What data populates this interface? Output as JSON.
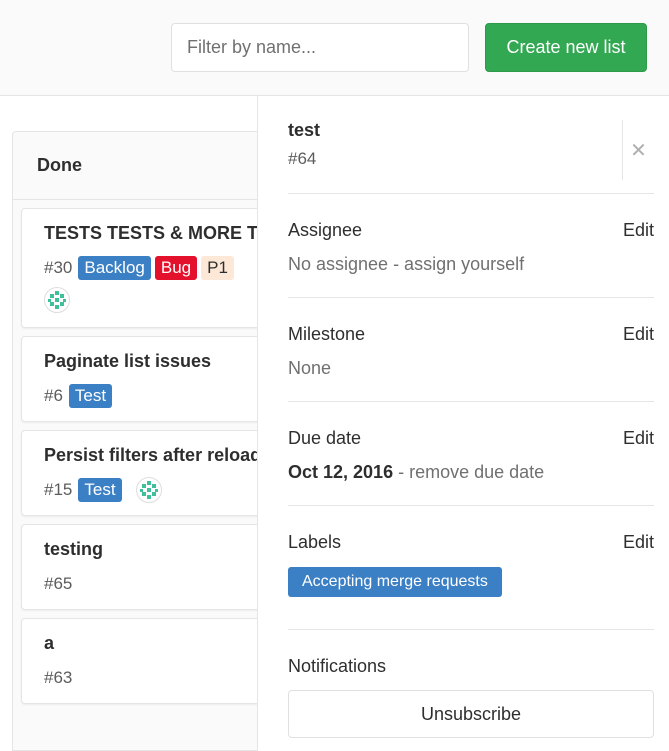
{
  "toolbar": {
    "filter_placeholder": "Filter by name...",
    "create_label": "Create new list"
  },
  "list": {
    "title": "Done",
    "cards": [
      {
        "title": "TESTS TESTS & MORE TESTS",
        "number": "#30",
        "labels": [
          {
            "text": "Backlog",
            "color": "#3b7fc4",
            "text_color": "#ffffff"
          },
          {
            "text": "Bug",
            "color": "#e4112c",
            "text_color": "#ffffff"
          },
          {
            "text": "P1",
            "color": "#fde8d7",
            "text_color": "#2e2e2e"
          }
        ],
        "avatar": true
      },
      {
        "title": "Paginate list issues",
        "number": "#6",
        "labels": [
          {
            "text": "Test",
            "color": "#3b7fc4",
            "text_color": "#ffffff"
          }
        ],
        "avatar": false
      },
      {
        "title": "Persist filters after reload",
        "number": "#15",
        "labels": [
          {
            "text": "Test",
            "color": "#3b7fc4",
            "text_color": "#ffffff"
          }
        ],
        "avatar": true
      },
      {
        "title": "testing",
        "number": "#65",
        "labels": [],
        "avatar": false
      },
      {
        "title": "a",
        "number": "#63",
        "labels": [],
        "avatar": false
      }
    ]
  },
  "sidebar": {
    "title": "test",
    "ref": "#64",
    "assignee": {
      "heading": "Assignee",
      "edit": "Edit",
      "value": "No assignee - assign yourself"
    },
    "milestone": {
      "heading": "Milestone",
      "edit": "Edit",
      "value": "None"
    },
    "due_date": {
      "heading": "Due date",
      "edit": "Edit",
      "date": "Oct 12, 2016",
      "remove": " - remove due date"
    },
    "labels": {
      "heading": "Labels",
      "edit": "Edit",
      "value": "Accepting merge requests"
    },
    "notifications": {
      "heading": "Notifications",
      "button": "Unsubscribe"
    }
  },
  "colors": {
    "accent_green": "#32a852",
    "label_blue": "#3b7fc4",
    "label_red": "#e4112c",
    "label_peach": "#fde8d7"
  }
}
